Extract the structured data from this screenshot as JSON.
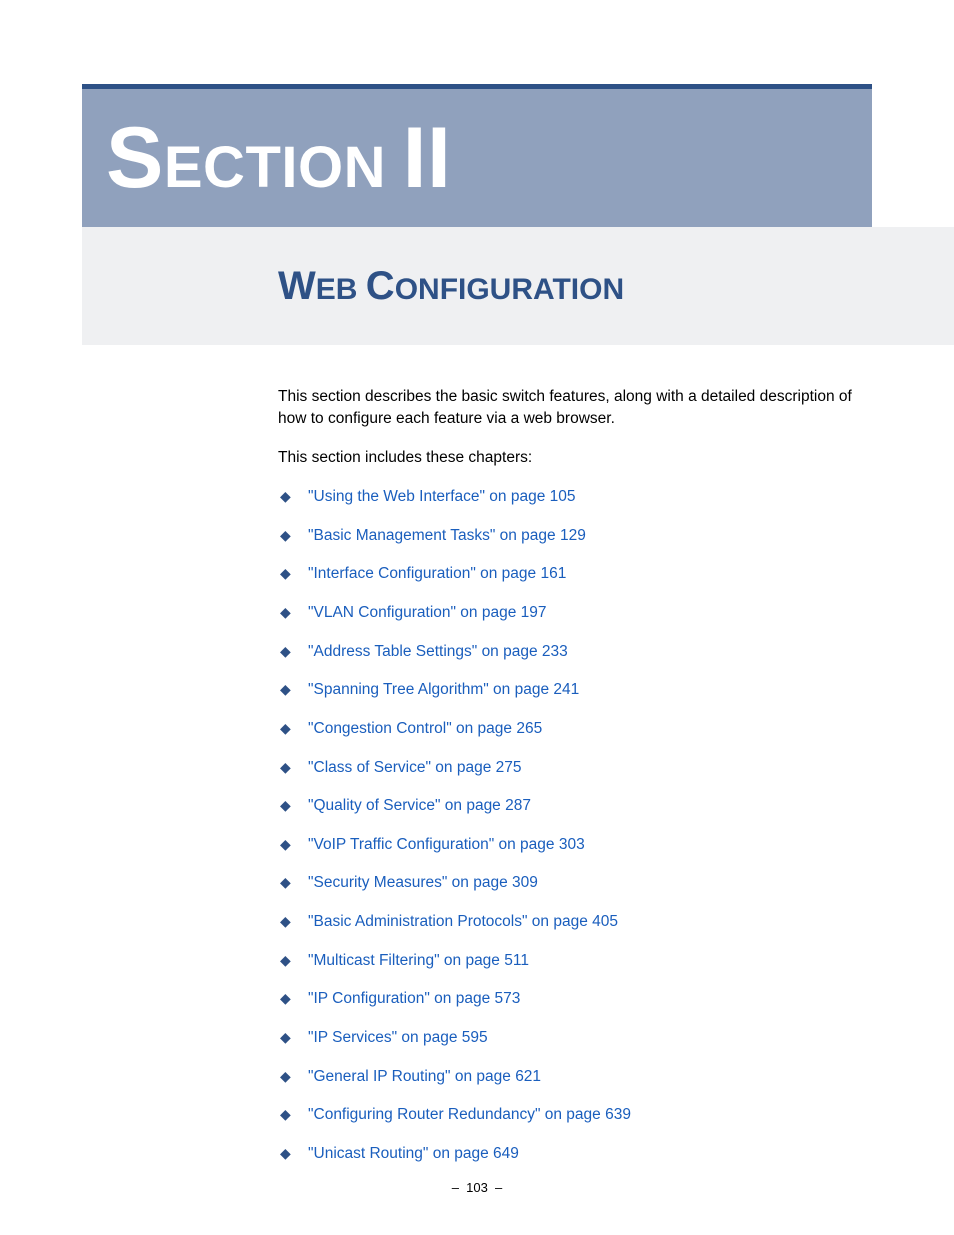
{
  "section": {
    "label_cap1": "S",
    "label_small1": "ECTION",
    "label_space": " ",
    "label_cap2": "II",
    "label_small2": ""
  },
  "heading": {
    "cap1": "W",
    "small1": "EB",
    "space1": " ",
    "cap2": "C",
    "small2": "ONFIGURATION"
  },
  "intro": {
    "p1": "This section describes the basic switch features, along with a detailed description of how to configure each feature via a web browser.",
    "p2": "This section includes these chapters:"
  },
  "chapters": [
    {
      "text": "\"Using the Web Interface\" on page 105"
    },
    {
      "text": "\"Basic Management Tasks\" on page 129"
    },
    {
      "text": "\"Interface Configuration\" on page 161"
    },
    {
      "text": "\"VLAN Configuration\" on page 197"
    },
    {
      "text": "\"Address Table Settings\" on page 233"
    },
    {
      "text": "\"Spanning Tree Algorithm\" on page 241"
    },
    {
      "text": "\"Congestion Control\" on page 265"
    },
    {
      "text": "\"Class of Service\" on page 275"
    },
    {
      "text": "\"Quality of Service\" on page 287"
    },
    {
      "text": "\"VoIP Traffic Configuration\" on page 303"
    },
    {
      "text": "\"Security Measures\" on page 309"
    },
    {
      "text": "\"Basic Administration Protocols\" on page 405"
    },
    {
      "text": "\"Multicast Filtering\" on page 511"
    },
    {
      "text": "\"IP Configuration\" on page 573"
    },
    {
      "text": "\"IP Services\" on page 595"
    },
    {
      "text": "\"General IP Routing\" on page 621"
    },
    {
      "text": "\"Configuring Router Redundancy\" on page 639"
    },
    {
      "text": "\"Unicast Routing\" on page 649"
    }
  ],
  "footer": {
    "page": "–  103  –"
  }
}
